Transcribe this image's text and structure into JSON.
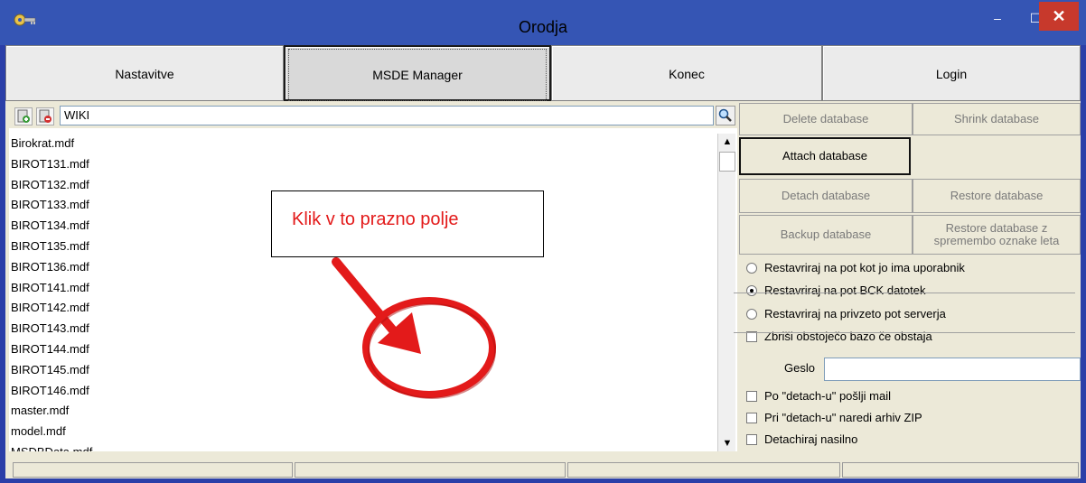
{
  "window": {
    "title": "Orodja",
    "minimize_glyph": "–",
    "maximize_glyph": "☐",
    "close_glyph": "✕",
    "icon": "key-icon"
  },
  "tabs": [
    {
      "label": "Nastavitve"
    },
    {
      "label": "MSDE Manager"
    },
    {
      "label": "Konec"
    },
    {
      "label": "Login"
    }
  ],
  "toolbar": {
    "search_value": "WIKI",
    "icons": [
      "add-database-icon",
      "remove-database-icon",
      "search-icon"
    ]
  },
  "files": [
    "Birokrat.mdf",
    "BIROT131.mdf",
    "BIROT132.mdf",
    "BIROT133.mdf",
    "BIROT134.mdf",
    "BIROT135.mdf",
    "BIROT136.mdf",
    "BIROT141.mdf",
    "BIROT142.mdf",
    "BIROT143.mdf",
    "BIROT144.mdf",
    "BIROT145.mdf",
    "BIROT146.mdf",
    "master.mdf",
    "model.mdf",
    "MSDBData.mdf"
  ],
  "actions": {
    "delete": "Delete database",
    "shrink": "Shrink database",
    "attach": "Attach database",
    "detach": "Detach database",
    "restore": "Restore database",
    "backup": "Backup database",
    "restore_change_year": "Restore database z spremembo oznake leta"
  },
  "restore_options": [
    {
      "label": "Restavriraj na pot kot jo ima uporabnik",
      "selected": false
    },
    {
      "label": "Restavriraj na pot BCK datotek",
      "selected": true
    },
    {
      "label": "Restavriraj na privzeto pot serverja",
      "selected": false
    }
  ],
  "delete_existing": {
    "label": "Zbriši obstoječo bazo če obstaja",
    "checked": false
  },
  "password": {
    "label": "Geslo",
    "value": ""
  },
  "detach_options": [
    {
      "label": "Po \"detach-u\" pošlji mail",
      "checked": false
    },
    {
      "label": "Pri \"detach-u\" naredi arhiv ZIP",
      "checked": false
    },
    {
      "label": "Detachiraj nasilno",
      "checked": false
    }
  ],
  "annotation": {
    "text": "Klik v to prazno polje",
    "color": "#e31a1a"
  }
}
